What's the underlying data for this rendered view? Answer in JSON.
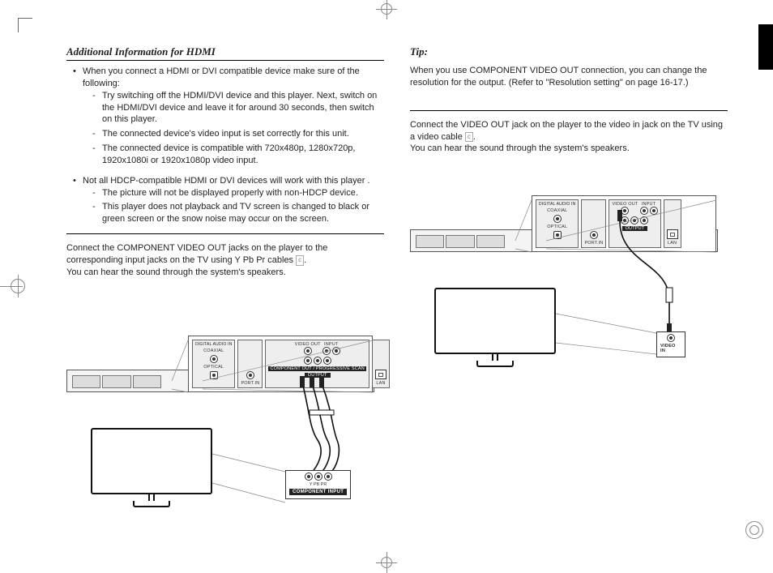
{
  "left": {
    "heading": "Additional Information for HDMI",
    "bullet1_intro": "When you connect a HDMI or DVI compatible device make sure of the following:",
    "dash1a": "Try switching off the HDMI/DVI device and this player. Next, switch on the HDMI/DVI device and leave it for around 30 seconds, then switch on this player.",
    "dash1b": "The connected device's video input is set correctly for this unit.",
    "dash1c": "The connected device is compatible with 720x480p, 1280x720p, 1920x1080i or 1920x1080p video input.",
    "bullet2_intro": "Not all HDCP-compatible HDMI or DVI devices will work with this player .",
    "dash2a": "The picture will not be displayed properly with non-HDCP  device.",
    "dash2b": "This player does not playback and TV screen is changed to black or green screen or the snow noise may occur on the screen.",
    "component_para1": "Connect the COMPONENT VIDEO OUT jacks on the player to the corresponding input jacks on the TV using Y Pb Pr cables",
    "component_para2": "You can hear the sound through the system's speakers.",
    "diagram": {
      "panel_labels": {
        "digital_audio_in": "DIGITAL AUDIO IN",
        "coaxial": "COAXIAL",
        "optical": "OPTICAL",
        "port_in": "PORT.IN",
        "video_out": "VIDEO OUT",
        "input": "INPUT",
        "output": "OUTPUT",
        "component_progressive": "COMPONENT OUT / PROGRESSIVE SCAN",
        "lan": "LAN"
      },
      "tv_panel_label": "COMPONENT INPUT",
      "tv_sub": "Y   PB   PR"
    }
  },
  "right": {
    "tip_heading": "Tip:",
    "tip_text": "When you use COMPONENT VIDEO OUT connection, you can change the resolution for the output. (Refer to \"Resolution setting\" on page 16-17.)",
    "video_para1": "Connect the VIDEO OUT jack on the player to the video in jack on the  TV using a video cable",
    "video_para2": "You can hear the sound through the system's speakers.",
    "diagram": {
      "panel_labels": {
        "digital_audio_in": "DIGITAL AUDIO IN",
        "coaxial": "COAXIAL",
        "optical": "OPTICAL",
        "port_in": "PORT.IN",
        "video_out": "VIDEO OUT",
        "input": "INPUT",
        "output": "OUTPUT",
        "lan": "LAN"
      },
      "tv_panel_label": "VIDEO IN"
    }
  }
}
